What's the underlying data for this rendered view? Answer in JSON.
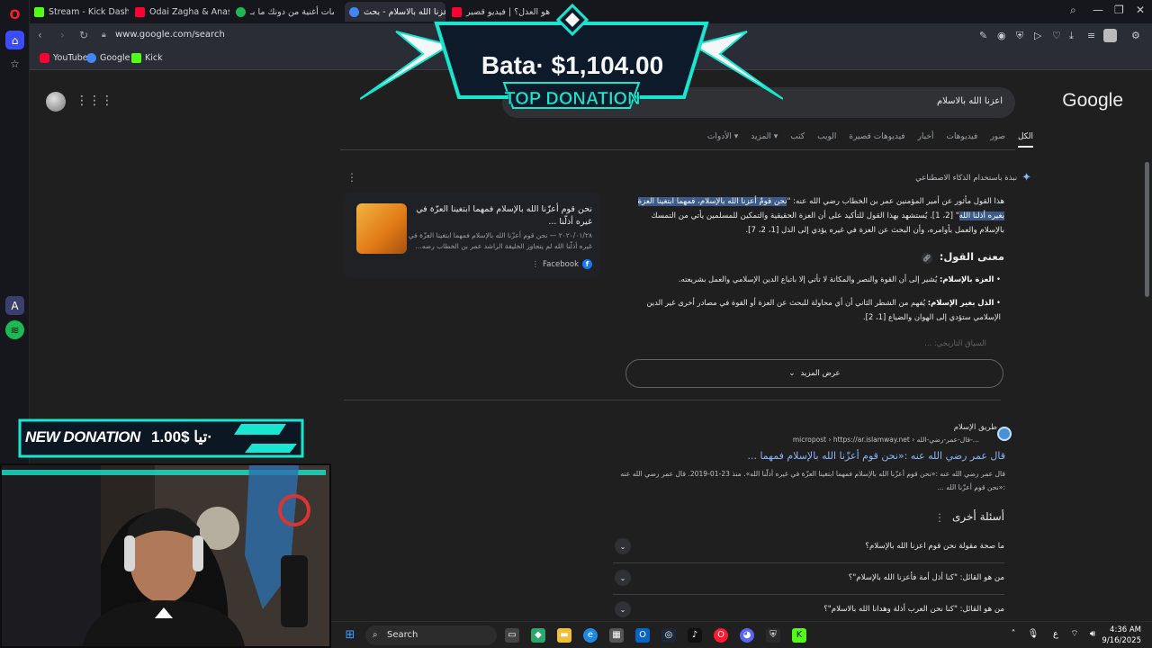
{
  "browser": {
    "tabs": [
      {
        "label": "Stream - Kick Dashboard",
        "favicon_color": "#53fc18"
      },
      {
        "label": "Odai Zagha & Anas Abu S",
        "favicon_color": "#ff0033"
      },
      {
        "label": "كلمات أغنية من دونك ما بـ",
        "favicon_color": "#1db954"
      },
      {
        "label": "اعزنا الله بالاسلام - بحث",
        "favicon_color": "#4285f4",
        "active": true
      },
      {
        "label": "ما هو العدل؟ | فيديو قصير",
        "favicon_color": "#ff0033"
      }
    ],
    "url": "www.google.com/search",
    "bookmarks": [
      {
        "label": "YouTube",
        "color": "#ff0033"
      },
      {
        "label": "Google",
        "color": "#4285f4"
      },
      {
        "label": "Kick",
        "color": "#53fc18"
      }
    ]
  },
  "google": {
    "logo": "Google",
    "query": "اعزنا الله بالاسلام",
    "tabs": [
      "الكل",
      "صور",
      "فيديوهات",
      "أخبار",
      "فيديوهات قصيرة",
      "الويب",
      "كتب",
      "المزيد ▾",
      "الأدوات ▾"
    ],
    "ai_overview": {
      "header": "نبذة باستخدام الذكاء الاصطناعي",
      "para_prefix": "هذا القول مأثور عن أمير المؤمنين عمر بن الخطاب رضي الله عنه: \"",
      "para_highlight": "نحن قومٌ أعزنا الله بالإسلام، فمهما ابتغينا العزة بغيره أذلنا الله",
      "para_suffix": "\" [2، 1]. يُستشهد بهذا القول للتأكيد على أن العزة الحقيقية والتمكين للمسلمين يأتي من التمسك بالإسلام والعمل بأوامره، وأن البحث عن العزة في غيره يؤدي إلى الذل [1، 2، 7].",
      "meaning_title": "معنى القول:",
      "bullets": [
        {
          "bold": "العزة بالإسلام:",
          "text": " يُشير إلى أن القوة والنصر والمكانة لا تأتي إلا باتباع الدين الإسلامي والعمل بشريعته."
        },
        {
          "bold": "الذل بغير الإسلام:",
          "text": " يُفهم من الشطر الثاني أن أي محاولة للبحث عن العزة أو القوة في مصادر أخرى غير الدين الإسلامي ستؤدي إلى الهوان والضياع [1، 2]."
        }
      ],
      "faded_line": "السياق التاريخي: ...",
      "show_more": "عرض المزيد"
    },
    "side_card": {
      "title": "نحن قوم أعزّنا الله بالإسلام فمهما ابتغينا العزّة في غيره أذلّنا ...",
      "snippet": "٢٠٢٠/٠١/٢٨ — نحن قوم أعزّنا الله بالإسلام فمهما ابتغينا العزّة في غيره أذلّنا الله لم يتجاوز الخليفة الراشد عمر بن الخطاب رضه...",
      "source": "Facebook"
    },
    "result": {
      "site": "طريق الإسلام",
      "crumb": "micropost › https://ar.islamway.net › قال-عمر-رضي-الله-...",
      "title": "قال عمر رضي الله عنه :«نحن قوم أعزّنا الله بالإسلام فمهما ...",
      "snippet": "قال عمر رضي الله عنه :«نحن قوم أعزّنا الله بالإسلام فمهما ابتغينا العزّة في غيره أذلّنا الله». منذ 23-01-2019. قال عمر رضي الله عنه :«نحن قوم أعزّنا الله ..."
    },
    "paa": {
      "title": "أسئلة أخرى",
      "questions": [
        "ما صحة مقولة نحن قوم اعزنا الله بالإسلام؟",
        "من هو القائل: \"كنا أذل أمة فأعزنا الله بالإسلام\"؟",
        "من هو القائل: \"كنا نحن العرب أذلة وهدانا الله بالاسلام\"؟"
      ]
    }
  },
  "overlays": {
    "top_donation_amount": "Bata· $1,104.00",
    "top_donation_label": "TOP DONATION",
    "new_donation_label": "NEW DONATION",
    "new_donation_amount": "1.00$ تيا·",
    "accent": "#19e6d0"
  },
  "taskbar": {
    "search": "Search",
    "time": "4:36 AM",
    "date": "9/16/2025",
    "lang": "ع"
  }
}
